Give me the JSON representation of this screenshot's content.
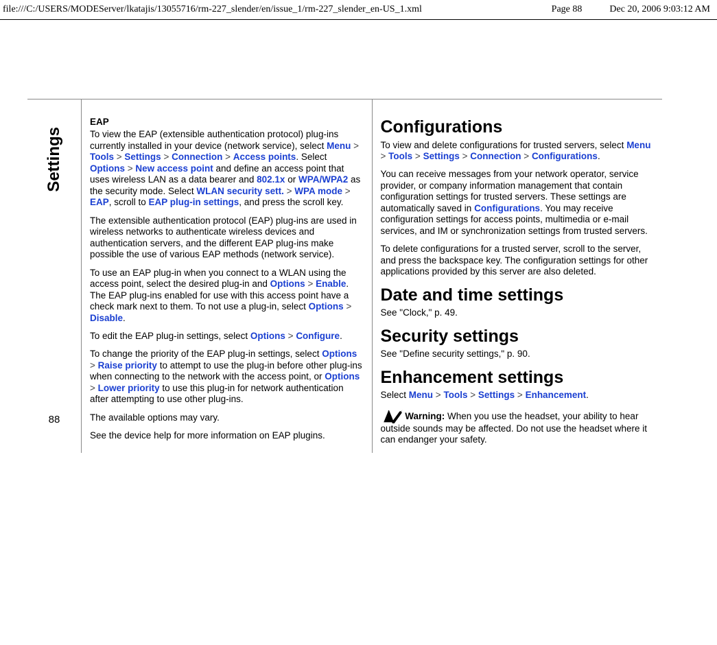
{
  "header": {
    "path": "file:///C:/USERS/MODEServer/lkatajis/13055716/rm-227_slender/en/issue_1/rm-227_slender_en-US_1.xml",
    "page": "Page 88",
    "date": "Dec 20, 2006 9:03:12 AM"
  },
  "side": {
    "title": "Settings",
    "pagenum": "88"
  },
  "c1": {
    "eap_h": "EAP",
    "p1a": "To view the EAP (extensible authentication protocol) plug-ins currently installed in your device (network service), select ",
    "menu": "Menu",
    "tools": "Tools",
    "settings": "Settings",
    "connection": "Connection",
    "accesspoints": "Access points",
    "options": "Options",
    "newap": "New access point",
    "p1b": ". Select ",
    "p1c": " and define an access point that uses wireless LAN as a data bearer and ",
    "x": "802.1x",
    "or": " or ",
    "wpa": "WPA/WPA2",
    "p1d": " as the security mode. Select ",
    "wlansec": "WLAN security sett.",
    "wpamode": "WPA mode",
    "eap": "EAP",
    "p1e": ", scroll to ",
    "eapplug": "EAP plug-in settings",
    "p1f": ", and press the scroll key.",
    "p2": "The extensible authentication protocol (EAP) plug-ins are used in wireless networks to authenticate wireless devices and authentication servers, and the different EAP plug-ins make possible the use of various EAP methods (network service).",
    "p3a": "To use an EAP plug-in when you connect to a WLAN using the access point, select the desired plug-in and ",
    "enable": "Enable",
    "p3b": ". The EAP plug-ins enabled for use with this access point have a check mark next to them. To not use a plug-in, select ",
    "disable": "Disable",
    "p3c": ".",
    "p4a": "To edit the EAP plug-in settings, select ",
    "configure": "Configure",
    "p4b": ".",
    "p5a": "To change the priority of the EAP plug-in settings, select ",
    "raise": "Raise priority",
    "p5b": " to attempt to use the plug-in before other plug-ins when connecting to the network with the access point, or ",
    "lower": "Lower priority",
    "p5c": " to use this plug-in for network authentication after attempting to use other plug-ins.",
    "p6": "The available options may vary.",
    "p7": "See the device help for more information on EAP plugins."
  },
  "c2": {
    "conf_h": "Configurations",
    "p1a": "To view and delete configurations for trusted servers, select ",
    "configurations": "Configurations",
    "p1b": ".",
    "p2a": "You can receive messages from your network operator, service provider, or company information management that contain configuration settings for trusted servers. These settings are automatically saved in ",
    "p2b": ". You may receive configuration settings for access points, multimedia or e-mail services, and IM or synchronization settings from trusted servers.",
    "p3": "To delete configurations for a trusted server, scroll to the server, and press the backspace key. The configuration settings for other applications provided by this server are also deleted.",
    "date_h": "Date and time settings",
    "date_sub": "See \"Clock,\" p. 49.",
    "sec_h": "Security settings",
    "sec_sub": "See \"Define security settings,\" p. 90.",
    "enh_h": "Enhancement settings",
    "enh_p_a": "Select ",
    "enhancement": "Enhancement",
    "enh_p_b": ".",
    "warn_label": "Warning:  ",
    "warn_text": "When you use the headset, your ability to hear outside sounds may be affected. Do not use the headset where it can endanger your safety."
  },
  "gt": ">"
}
